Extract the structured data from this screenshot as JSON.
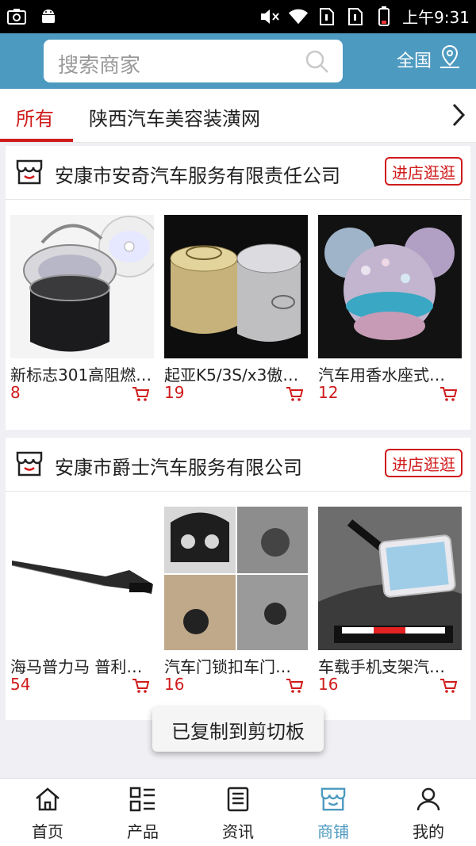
{
  "status_bar": {
    "time": "上午9:31",
    "icons": [
      "camera-icon",
      "android-icon",
      "mute-icon",
      "wifi-icon",
      "sim1-icon",
      "sim2-icon",
      "battery-icon"
    ]
  },
  "header": {
    "search_placeholder": "搜索商家",
    "region_label": "全国"
  },
  "tabs": [
    {
      "label": "所有",
      "active": true
    },
    {
      "label": "陕西汽车美容装潢网",
      "active": false
    }
  ],
  "shops": [
    {
      "name": "安康市安奇汽车服务有限责任公司",
      "visit_label": "进店逛逛",
      "products": [
        {
          "name": "新标志301高阻燃…",
          "price": "8"
        },
        {
          "name": "起亚K5/3S/x3傲…",
          "price": "19"
        },
        {
          "name": "汽车用香水座式…",
          "price": "12"
        }
      ]
    },
    {
      "name": "安康市爵士汽车服务有限公司",
      "visit_label": "进店逛逛",
      "products": [
        {
          "name": "海马普力马 普利…",
          "price": "54"
        },
        {
          "name": "汽车门锁扣车门…",
          "price": "16"
        },
        {
          "name": "车载手机支架汽…",
          "price": "16"
        }
      ]
    }
  ],
  "toast": "已复制到剪切板",
  "bottom_nav": [
    {
      "label": "首页",
      "icon": "home-icon",
      "active": false
    },
    {
      "label": "产品",
      "icon": "grid-list-icon",
      "active": false
    },
    {
      "label": "资讯",
      "icon": "news-icon",
      "active": false
    },
    {
      "label": "商铺",
      "icon": "store-icon",
      "active": true
    },
    {
      "label": "我的",
      "icon": "user-icon",
      "active": false
    }
  ],
  "colors": {
    "primary": "#4d9ac0",
    "accent_red": "#d01b1b",
    "background": "#efeff4"
  }
}
